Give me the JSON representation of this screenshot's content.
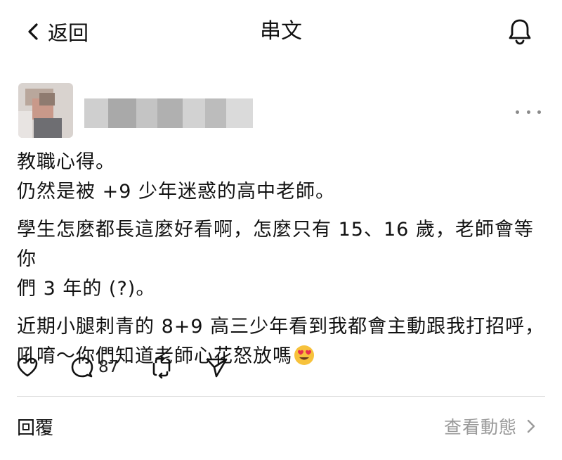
{
  "header": {
    "back_label": "返回",
    "title": "串文",
    "back_icon": "chevron-left-icon",
    "bell_icon": "bell-icon"
  },
  "post": {
    "lines": [
      "教職心得。",
      "仍然是被 +9 少年迷惑的高中老師。",
      "學生怎麼都長這麼好看啊，怎麼只有 15、16 歲，老師會等你",
      "們 3 年的 (?)。",
      "近期小腿刺青的 8+9 高三少年看到我都會主動跟我打招呼，",
      "吼唷～你們知道老師心花怒放嗎"
    ],
    "emoji": "heart-eyes-emoji"
  },
  "actions": {
    "like_icon": "heart-icon",
    "comment_icon": "comment-icon",
    "comment_count": "87",
    "repost_icon": "repost-icon",
    "share_icon": "send-icon"
  },
  "footer": {
    "reply_label": "回覆",
    "activity_label": "查看動態"
  },
  "colors": {
    "text": "#111111",
    "muted": "#9a9a9a",
    "divider": "#dcdcdc",
    "background": "#ffffff"
  }
}
